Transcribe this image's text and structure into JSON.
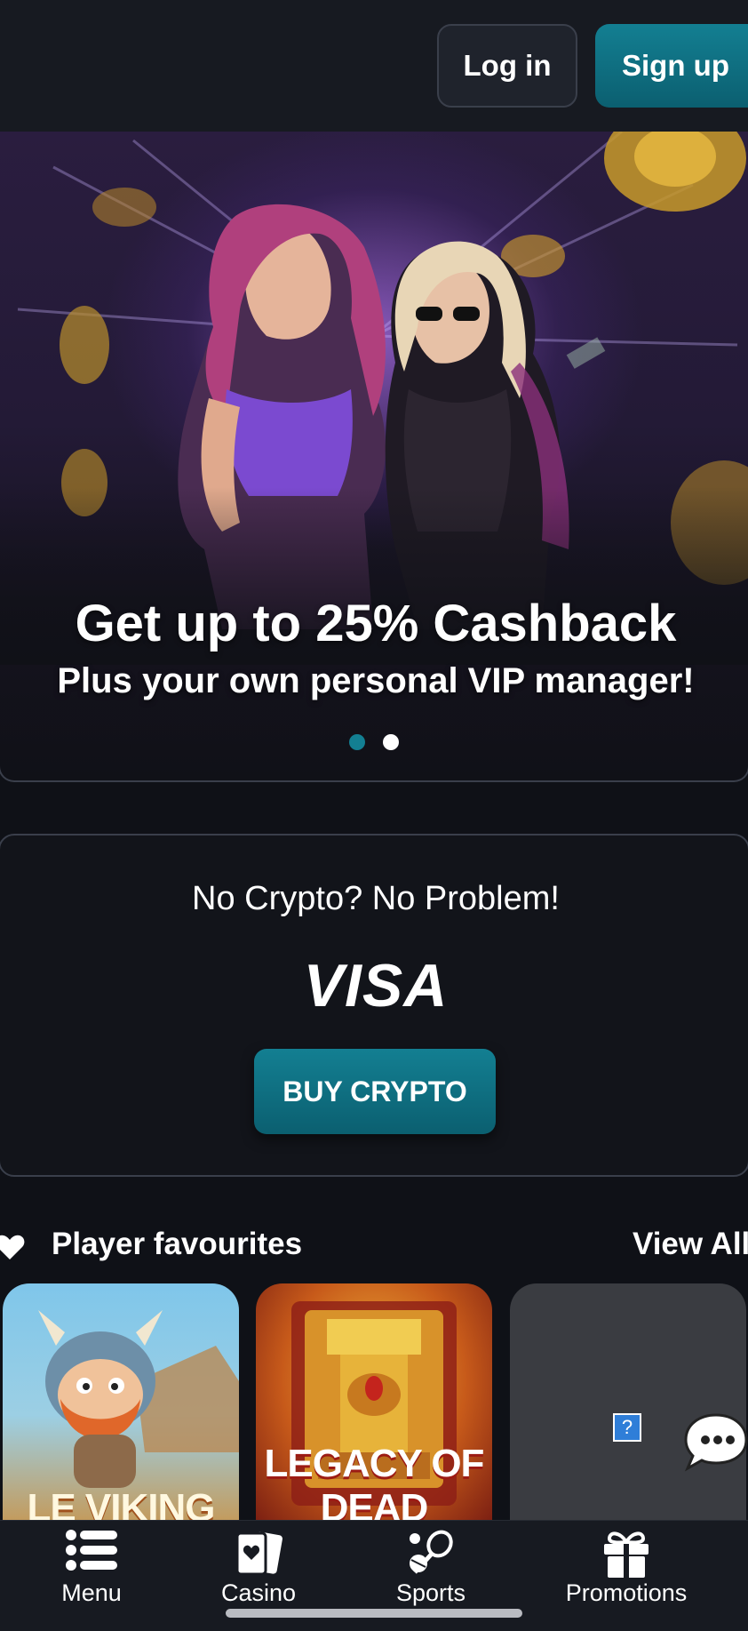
{
  "header": {
    "login_label": "Log in",
    "signup_label": "Sign up"
  },
  "hero": {
    "title": "Get up to 25% Cashback",
    "subtitle": "Plus your own personal VIP manager!",
    "slides_count": 2,
    "active_slide": 1
  },
  "crypto_card": {
    "heading": "No Crypto? No Problem!",
    "logo_text": "VISA",
    "button_label": "BUY CRYPTO"
  },
  "favourites": {
    "title": "Player favourites",
    "view_all": "View All",
    "games": [
      {
        "name": "LE VIKING"
      },
      {
        "name": "LEGACY OF DEAD"
      },
      {
        "name": ""
      }
    ]
  },
  "bottom_nav": {
    "items": [
      {
        "label": "Menu",
        "icon": "menu-list-icon"
      },
      {
        "label": "Casino",
        "icon": "playing-cards-icon"
      },
      {
        "label": "Sports",
        "icon": "sports-equipment-icon"
      },
      {
        "label": "Promotions",
        "icon": "gift-icon"
      }
    ]
  },
  "colors": {
    "accent": "#137f92",
    "background": "#0f1117",
    "header": "#171a21"
  }
}
